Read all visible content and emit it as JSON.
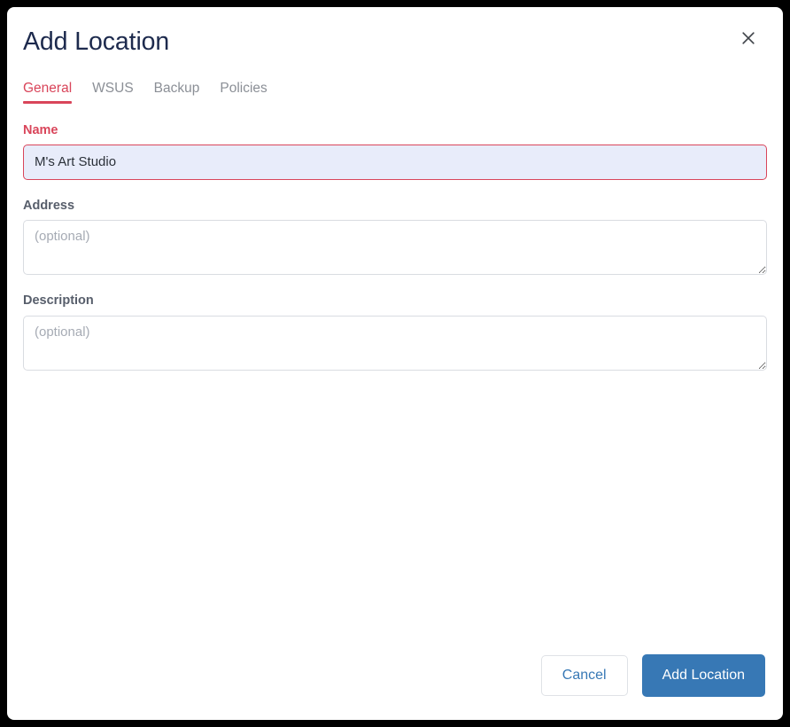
{
  "dialog": {
    "title": "Add Location",
    "close_icon": "close-icon"
  },
  "tabs": [
    {
      "label": "General",
      "active": true
    },
    {
      "label": "WSUS",
      "active": false
    },
    {
      "label": "Backup",
      "active": false
    },
    {
      "label": "Policies",
      "active": false
    }
  ],
  "form": {
    "name": {
      "label": "Name",
      "value": "M's Art Studio",
      "placeholder": ""
    },
    "address": {
      "label": "Address",
      "value": "",
      "placeholder": "(optional)"
    },
    "description": {
      "label": "Description",
      "value": "",
      "placeholder": "(optional)"
    }
  },
  "footer": {
    "cancel_label": "Cancel",
    "submit_label": "Add Location"
  },
  "colors": {
    "accent_red": "#d9455a",
    "primary_blue": "#3778b5",
    "title_navy": "#1d2a4d",
    "label_gray": "#575e6b",
    "tab_inactive": "#8b8f96",
    "input_autofill_bg": "#e8ecfa"
  }
}
